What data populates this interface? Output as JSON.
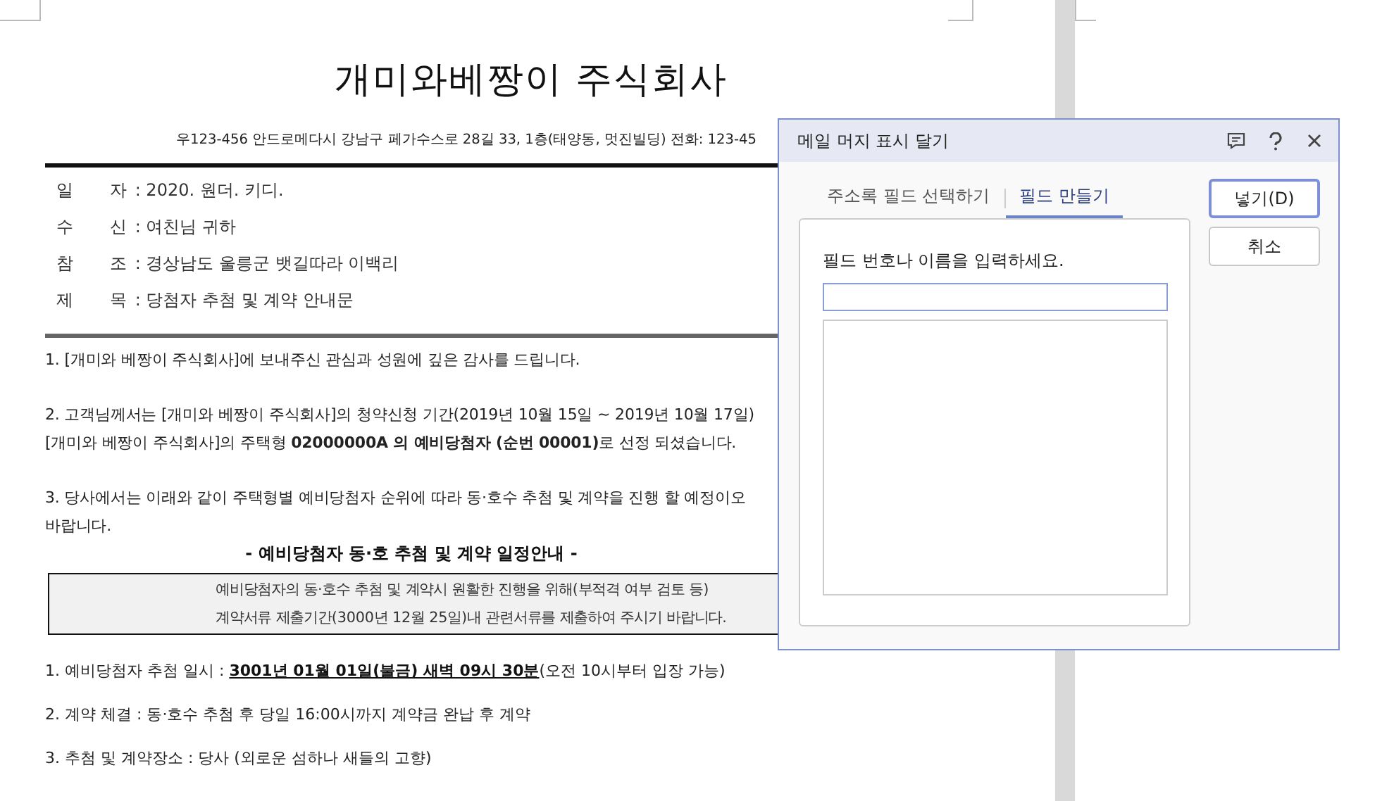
{
  "document": {
    "title": "개미와베짱이 주식회사",
    "address": "우123-456 안드로메다시 강남구 페가수스로 28길 33, 1층(태양동, 멋진빌딩) 전화: 123-45",
    "header_fields": [
      {
        "label": "일 자",
        "value": ": 2020. 원더. 키디."
      },
      {
        "label": "수 신",
        "value": ": 여친님 귀하"
      },
      {
        "label": "참 조",
        "value": ": 경상남도 울릉군 뱃길따라 이백리"
      },
      {
        "label": "제 목",
        "value": ": 당첨자 추첨 및 계약 안내문"
      }
    ],
    "paragraphs": [
      [
        "1. [개미와 베짱이 주식회사]에 보내주신 관심과 성원에 깊은 감사를 드립니다."
      ],
      [
        "2. 고객님께서는 [개미와 베짱이 주식회사]의 청약신청 기간(2019년 10월 15일 ~ 2019년 10월 17일)",
        "[개미와 베짱이 주식회사]의 주택형 **02000000A 의 예비당첨자 (순번 00001)**로 선정 되셨습니다."
      ],
      [
        "3. 당사에서는 이래와 같이 주택형별 예비당첨자 순위에 따라 동·호수 추첨 및 계약을 진행 할 예정이오",
        "바랍니다."
      ]
    ],
    "section_heading": "- 예비당첨자 동·호 추첨 및 계약 일정안내 -",
    "notice_box": [
      "예비당첨자의 동·호수 추첨 및 계약시 원활한 진행을 위해(부적격 여부 검토 등)",
      "계약서류 제출기간(3000년 12월 25일)내 관련서류를 제출하여 주시기 바랍니다."
    ],
    "schedule": [
      {
        "prefix": "1. 예비당첨자 추첨 일시 : ",
        "emphasis": "3001년 01월 01일(불금) 새벽 09시 30분",
        "suffix": "(오전 10시부터 입장 가능)"
      },
      {
        "prefix": "2. 계약 체결 : 동·호수 추첨 후 당일 16:00시까지 계약금 완납 후 계약"
      },
      {
        "prefix": "3. 추첨 및 계약장소 : 당사 (외로운 섬하나 새들의 고향)"
      }
    ]
  },
  "dialog": {
    "title": "메일 머지 표시 달기",
    "tabs": [
      {
        "label": "주소록 필드 선택하기",
        "selected": false
      },
      {
        "label": "필드 만들기",
        "selected": true
      }
    ],
    "prompt": "필드 번호나 이름을 입력하세요.",
    "buttons": [
      {
        "label": "넣기(D)",
        "default": true
      },
      {
        "label": "취소",
        "default": false
      }
    ]
  }
}
